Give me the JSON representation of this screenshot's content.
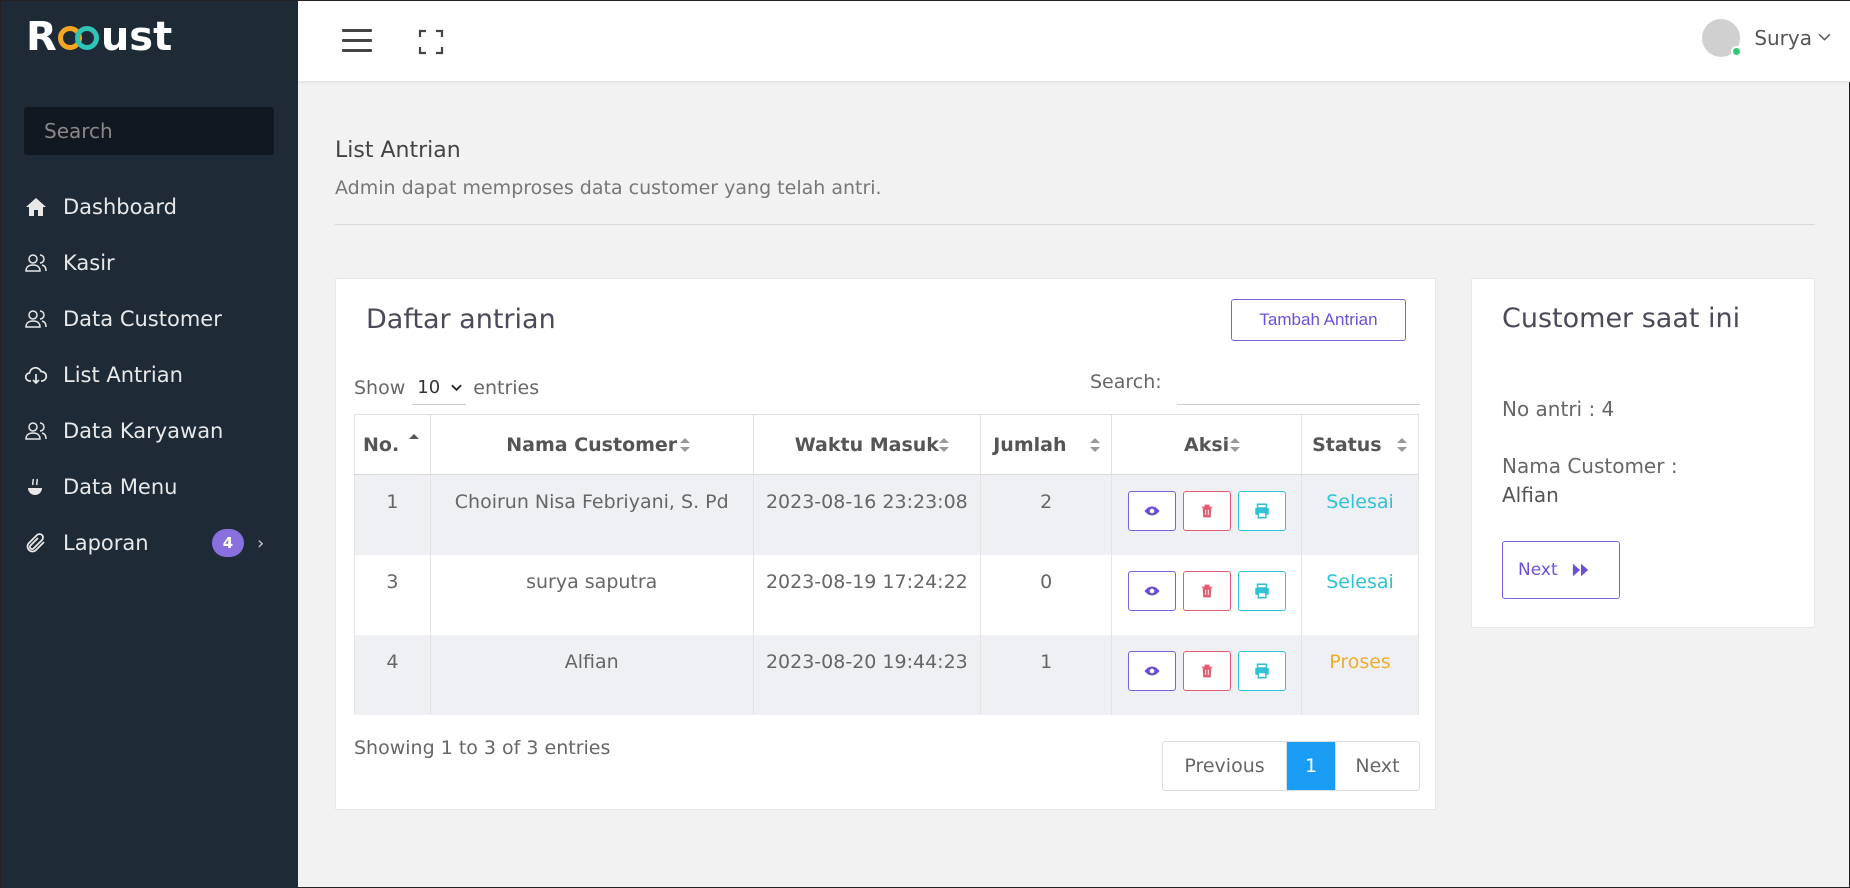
{
  "brand": {
    "pre": "R",
    "post": "ust"
  },
  "sidebar": {
    "search_placeholder": "Search",
    "items": [
      {
        "label": "Dashboard",
        "icon": "home-icon"
      },
      {
        "label": "Kasir",
        "icon": "users-icon"
      },
      {
        "label": "Data Customer",
        "icon": "users-icon"
      },
      {
        "label": "List Antrian",
        "icon": "cloud-download-icon"
      },
      {
        "label": "Data Karyawan",
        "icon": "users-icon"
      },
      {
        "label": "Data Menu",
        "icon": "coffee-icon"
      },
      {
        "label": "Laporan",
        "icon": "paperclip-icon",
        "badge": "4"
      }
    ]
  },
  "topbar": {
    "user_name": "Surya"
  },
  "page": {
    "title": "List Antrian",
    "subtitle": "Admin dapat memproses data customer yang telah antri."
  },
  "queue_card": {
    "title": "Daftar antrian",
    "add_button": "Tambah Antrian",
    "show_label": "Show",
    "entries_value": "10",
    "entries_label": "entries",
    "search_label": "Search:",
    "columns": [
      "No.",
      "Nama Customer",
      "Waktu Masuk",
      "Jumlah",
      "Aksi",
      "Status"
    ],
    "rows": [
      {
        "no": "1",
        "nama": "Choirun Nisa Febriyani, S. Pd",
        "waktu": "2023-08-16 23:23:08",
        "jumlah": "2",
        "status": "Selesai"
      },
      {
        "no": "3",
        "nama": "surya saputra",
        "waktu": "2023-08-19 17:24:22",
        "jumlah": "0",
        "status": "Selesai"
      },
      {
        "no": "4",
        "nama": "Alfian",
        "waktu": "2023-08-20 19:44:23",
        "jumlah": "1",
        "status": "Proses"
      }
    ],
    "showing": "Showing 1 to 3 of 3 entries",
    "pager": {
      "prev": "Previous",
      "page": "1",
      "next": "Next"
    }
  },
  "current_card": {
    "title": "Customer saat ini",
    "no_antri": "No antri : 4",
    "nama_label": "Nama Customer :",
    "nama_value": "Alfian",
    "next_button": "Next"
  },
  "colors": {
    "accent": "#7a5fe0",
    "done": "#2fc2d6",
    "process": "#f0ad2b",
    "sidebar": "#1e2a36",
    "page_active": "#1a9ef5"
  }
}
